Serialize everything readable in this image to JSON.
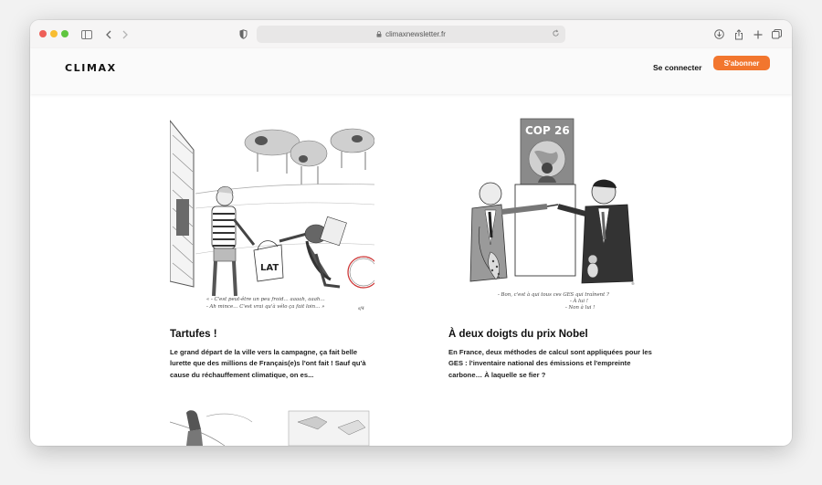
{
  "browser": {
    "url": "climaxnewsletter.fr"
  },
  "header": {
    "logo": "CLIMAX",
    "login": "Se connecter",
    "subscribe": "S'abonner"
  },
  "articles": [
    {
      "title": "Tartufes !",
      "excerpt": "Le grand départ de la ville vers la campagne, ça fait belle lurette que des millions de Français(e)s l'ont fait ! Sauf qu'à cause du réchauffement climatique, on es...",
      "caption_lines": [
        "« - C'est peut-être un peu froid… aaaah, aaah…",
        "- Ah mince… C'est vrai qu'à vélo ça fait loin… »"
      ],
      "bag_text": "LAT",
      "signature": "sf4"
    },
    {
      "title": "À deux doigts du prix Nobel",
      "excerpt": "En France, deux méthodes de calcul sont appliquées pour les GES : l'inventaire national des émissions et l'empreinte carbone… À laquelle se fier ?",
      "caption_lines": [
        "- Bon, c'est à qui tous ces GES qui traînent ?",
        "- À lui !",
        "- Non à lui !"
      ],
      "poster_text": "COP 26"
    }
  ]
}
